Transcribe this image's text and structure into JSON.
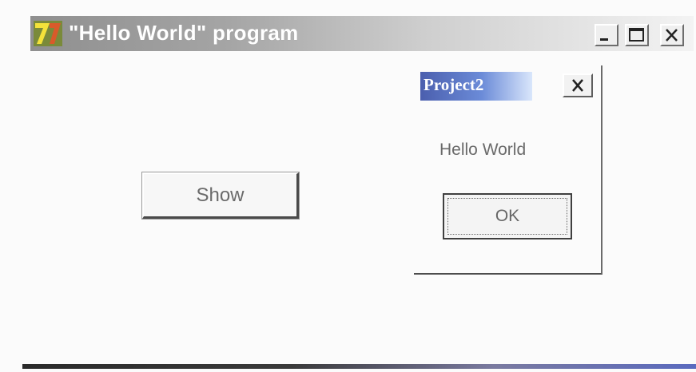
{
  "main_window": {
    "title": "\"Hello World\" program",
    "show_button_label": "Show"
  },
  "dialog": {
    "title": "Project2",
    "message": "Hello World",
    "ok_label": "OK"
  },
  "icons": {
    "app_icon": "app-icon",
    "minimize": "minimize-icon",
    "maximize": "maximize-icon",
    "close": "close-icon"
  },
  "colors": {
    "dialog_title_accent": "#4b5fae"
  }
}
